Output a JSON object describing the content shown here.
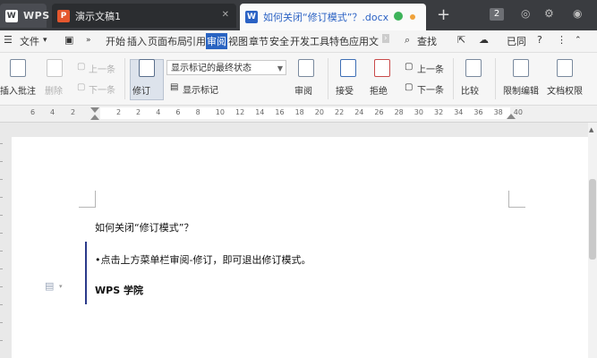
{
  "tabs": {
    "home": "WPS",
    "presentation": "演示文稿1",
    "document": "如何关闭“修订模式”？.docx"
  },
  "window": {
    "count": "2",
    "plus": "+"
  },
  "menu": {
    "file": "文件",
    "items": [
      "开始",
      "插入",
      "页面布局",
      "引用",
      "审阅",
      "视图",
      "章节",
      "安全",
      "开发工具",
      "特色应用",
      "文"
    ],
    "active": "审阅",
    "search": "查找",
    "unsaved": "已同",
    "help": "?"
  },
  "ribbon": {
    "insert_comment": "插入批注",
    "delete": "删除",
    "prev_comment": "上一条",
    "next_comment": "下一条",
    "track_changes": "修订",
    "display_combo": "显示标记的最终状态",
    "show_markup": "显示标记",
    "review": "审阅",
    "accept": "接受",
    "reject": "拒绝",
    "prev_change": "上一条",
    "next_change": "下一条",
    "compare": "比较",
    "restrict_edit": "限制编辑",
    "doc_rights": "文档权限"
  },
  "ruler": {
    "left_ticks": [
      "6",
      "4",
      "2",
      "2"
    ],
    "right_ticks": [
      "2",
      "4",
      "6",
      "8",
      "10",
      "12",
      "14",
      "16",
      "18",
      "20",
      "22",
      "24",
      "26",
      "28",
      "30",
      "32",
      "34",
      "36",
      "38",
      "40"
    ]
  },
  "document": {
    "line1": "如何关闭“修订模式”？",
    "line2": "•点击上方菜单栏审阅-修订，即可退出修订模式。",
    "line3": "WPS 学院"
  },
  "colors": {
    "accent": "#2a64c2",
    "tabbar": "#3a3c40",
    "revision_bar": "#2b3a8a"
  }
}
